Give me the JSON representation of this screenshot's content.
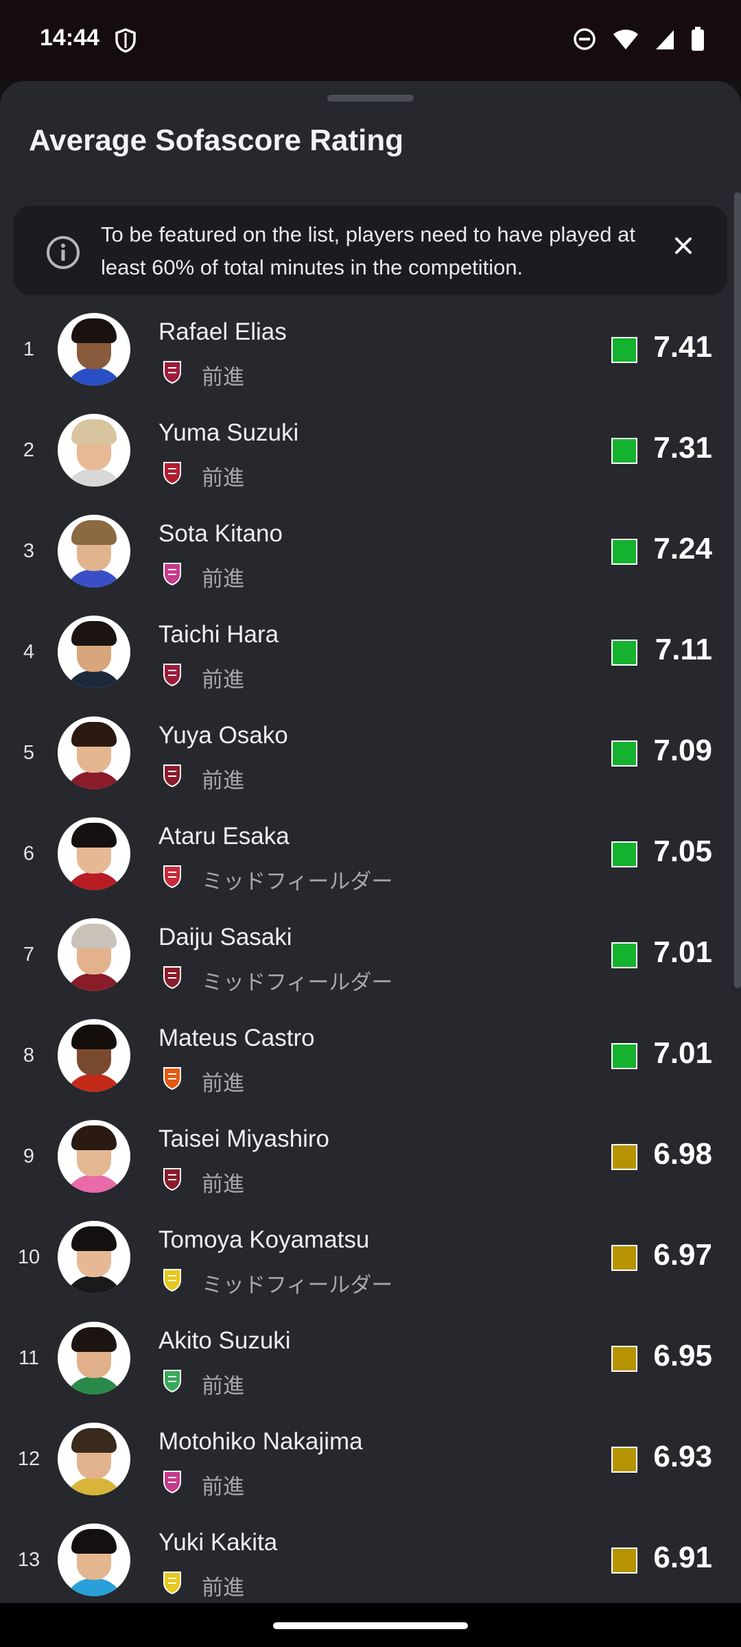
{
  "status_bar": {
    "time": "14:44"
  },
  "sheet": {
    "title": "Average Sofascore Rating",
    "info": "To be featured on the list, players need to have played at least 60% of total minutes in the competition."
  },
  "colors": {
    "rating_green": "#15b22f",
    "rating_yellow": "#b69300",
    "background": "#26282d"
  },
  "players": [
    {
      "rank": "1",
      "name": "Rafael Elias",
      "position": "前進",
      "rating": "7.41",
      "rating_color": "#15b22f",
      "team_icon": "kyoto-sanga-badge-icon",
      "team_color": "#9b1c3a",
      "skin": "#8a5a3c",
      "hair": "#1a1210",
      "shirt": "#2a4fc4"
    },
    {
      "rank": "2",
      "name": "Yuma Suzuki",
      "position": "前進",
      "rating": "7.31",
      "rating_color": "#15b22f",
      "team_icon": "kashima-antlers-badge-icon",
      "team_color": "#b01c2e",
      "skin": "#e8b995",
      "hair": "#d9c4a0",
      "shirt": "#d8d8d8"
    },
    {
      "rank": "3",
      "name": "Sota Kitano",
      "position": "前進",
      "rating": "7.24",
      "rating_color": "#15b22f",
      "team_icon": "cerezo-osaka-badge-icon",
      "team_color": "#c43c8c",
      "skin": "#e2b48e",
      "hair": "#8a6a40",
      "shirt": "#3a4ec8"
    },
    {
      "rank": "4",
      "name": "Taichi Hara",
      "position": "前進",
      "rating": "7.11",
      "rating_color": "#15b22f",
      "team_icon": "kyoto-sanga-badge-icon",
      "team_color": "#9b1c3a",
      "skin": "#d8a67c",
      "hair": "#1c1410",
      "shirt": "#1e2a3c"
    },
    {
      "rank": "5",
      "name": "Yuya Osako",
      "position": "前進",
      "rating": "7.09",
      "rating_color": "#15b22f",
      "team_icon": "vissel-kobe-badge-icon",
      "team_color": "#8a1c2a",
      "skin": "#e4b690",
      "hair": "#2a1a12",
      "shirt": "#8a1c2a"
    },
    {
      "rank": "6",
      "name": "Ataru Esaka",
      "position": "ミッドフィールダー",
      "rating": "7.05",
      "rating_color": "#15b22f",
      "team_icon": "fagiano-okayama-badge-icon",
      "team_color": "#c42a3a",
      "skin": "#e6b894",
      "hair": "#141010",
      "shirt": "#b81c24"
    },
    {
      "rank": "7",
      "name": "Daiju Sasaki",
      "position": "ミッドフィールダー",
      "rating": "7.01",
      "rating_color": "#15b22f",
      "team_icon": "vissel-kobe-badge-icon",
      "team_color": "#8a1c2a",
      "skin": "#e2b28c",
      "hair": "#c8c2b8",
      "shirt": "#8a1c2a"
    },
    {
      "rank": "8",
      "name": "Mateus Castro",
      "position": "前進",
      "rating": "7.01",
      "rating_color": "#15b22f",
      "team_icon": "nagoya-grampus-badge-icon",
      "team_color": "#e05a12",
      "skin": "#7a4a30",
      "hair": "#140e0a",
      "shirt": "#c42a18"
    },
    {
      "rank": "9",
      "name": "Taisei Miyashiro",
      "position": "前進",
      "rating": "6.98",
      "rating_color": "#b69300",
      "team_icon": "vissel-kobe-badge-icon",
      "team_color": "#8a1c2a",
      "skin": "#e4b892",
      "hair": "#2a1a12",
      "shirt": "#e86aa8"
    },
    {
      "rank": "10",
      "name": "Tomoya Koyamatsu",
      "position": "ミッドフィールダー",
      "rating": "6.97",
      "rating_color": "#b69300",
      "team_icon": "kashiwa-reysol-badge-icon",
      "team_color": "#e8c81c",
      "skin": "#e6b894",
      "hair": "#141010",
      "shirt": "#1a1a1a"
    },
    {
      "rank": "11",
      "name": "Akito Suzuki",
      "position": "前進",
      "rating": "6.95",
      "rating_color": "#b69300",
      "team_icon": "shonan-bellmare-badge-icon",
      "team_color": "#3aa85a",
      "skin": "#e0b08a",
      "hair": "#1c1410",
      "shirt": "#2a8a4a"
    },
    {
      "rank": "12",
      "name": "Motohiko Nakajima",
      "position": "前進",
      "rating": "6.93",
      "rating_color": "#b69300",
      "team_icon": "cerezo-osaka-badge-icon",
      "team_color": "#c43c8c",
      "skin": "#e2b28c",
      "hair": "#3a2a1c",
      "shirt": "#d8b43a"
    },
    {
      "rank": "13",
      "name": "Yuki Kakita",
      "position": "前進",
      "rating": "6.91",
      "rating_color": "#b69300",
      "team_icon": "kashiwa-reysol-badge-icon",
      "team_color": "#e8c81c",
      "skin": "#e4b690",
      "hair": "#141010",
      "shirt": "#2aa0d8"
    }
  ]
}
